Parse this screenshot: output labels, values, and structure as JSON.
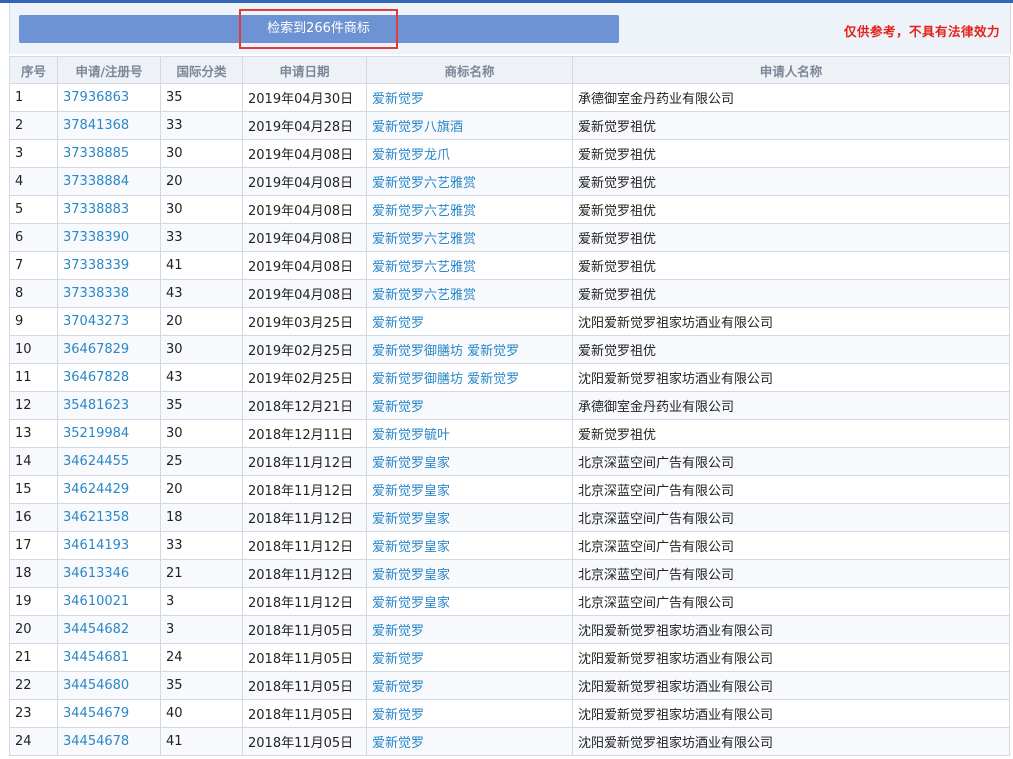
{
  "header": {
    "result_text": "检索到266件商标",
    "disclaimer": "仅供参考，不具有法律效力"
  },
  "table": {
    "columns": [
      "序号",
      "申请/注册号",
      "国际分类",
      "申请日期",
      "商标名称",
      "申请人名称"
    ],
    "rows": [
      {
        "no": "1",
        "reg": "37936863",
        "cls": "35",
        "date": "2019年04月30日",
        "name": "爱新觉罗",
        "applicant": "承德御室金丹药业有限公司"
      },
      {
        "no": "2",
        "reg": "37841368",
        "cls": "33",
        "date": "2019年04月28日",
        "name": "爱新觉罗八旗酒",
        "applicant": "爱新觉罗祖优"
      },
      {
        "no": "3",
        "reg": "37338885",
        "cls": "30",
        "date": "2019年04月08日",
        "name": "爱新觉罗龙爪",
        "applicant": "爱新觉罗祖优"
      },
      {
        "no": "4",
        "reg": "37338884",
        "cls": "20",
        "date": "2019年04月08日",
        "name": "爱新觉罗六艺雅赏",
        "applicant": "爱新觉罗祖优"
      },
      {
        "no": "5",
        "reg": "37338883",
        "cls": "30",
        "date": "2019年04月08日",
        "name": "爱新觉罗六艺雅赏",
        "applicant": "爱新觉罗祖优"
      },
      {
        "no": "6",
        "reg": "37338390",
        "cls": "33",
        "date": "2019年04月08日",
        "name": "爱新觉罗六艺雅赏",
        "applicant": "爱新觉罗祖优"
      },
      {
        "no": "7",
        "reg": "37338339",
        "cls": "41",
        "date": "2019年04月08日",
        "name": "爱新觉罗六艺雅赏",
        "applicant": "爱新觉罗祖优"
      },
      {
        "no": "8",
        "reg": "37338338",
        "cls": "43",
        "date": "2019年04月08日",
        "name": "爱新觉罗六艺雅赏",
        "applicant": "爱新觉罗祖优"
      },
      {
        "no": "9",
        "reg": "37043273",
        "cls": "20",
        "date": "2019年03月25日",
        "name": "爱新觉罗",
        "applicant": "沈阳爱新觉罗祖家坊酒业有限公司"
      },
      {
        "no": "10",
        "reg": "36467829",
        "cls": "30",
        "date": "2019年02月25日",
        "name": "爱新觉罗御膳坊 爱新觉罗",
        "applicant": "爱新觉罗祖优"
      },
      {
        "no": "11",
        "reg": "36467828",
        "cls": "43",
        "date": "2019年02月25日",
        "name": "爱新觉罗御膳坊 爱新觉罗",
        "applicant": "沈阳爱新觉罗祖家坊酒业有限公司"
      },
      {
        "no": "12",
        "reg": "35481623",
        "cls": "35",
        "date": "2018年12月21日",
        "name": "爱新觉罗",
        "applicant": "承德御室金丹药业有限公司"
      },
      {
        "no": "13",
        "reg": "35219984",
        "cls": "30",
        "date": "2018年12月11日",
        "name": "爱新觉罗毓叶",
        "applicant": "爱新觉罗祖优"
      },
      {
        "no": "14",
        "reg": "34624455",
        "cls": "25",
        "date": "2018年11月12日",
        "name": "爱新觉罗皇家",
        "applicant": "北京深蓝空间广告有限公司"
      },
      {
        "no": "15",
        "reg": "34624429",
        "cls": "20",
        "date": "2018年11月12日",
        "name": "爱新觉罗皇家",
        "applicant": "北京深蓝空间广告有限公司"
      },
      {
        "no": "16",
        "reg": "34621358",
        "cls": "18",
        "date": "2018年11月12日",
        "name": "爱新觉罗皇家",
        "applicant": "北京深蓝空间广告有限公司"
      },
      {
        "no": "17",
        "reg": "34614193",
        "cls": "33",
        "date": "2018年11月12日",
        "name": "爱新觉罗皇家",
        "applicant": "北京深蓝空间广告有限公司"
      },
      {
        "no": "18",
        "reg": "34613346",
        "cls": "21",
        "date": "2018年11月12日",
        "name": "爱新觉罗皇家",
        "applicant": "北京深蓝空间广告有限公司"
      },
      {
        "no": "19",
        "reg": "34610021",
        "cls": "3",
        "date": "2018年11月12日",
        "name": "爱新觉罗皇家",
        "applicant": "北京深蓝空间广告有限公司"
      },
      {
        "no": "20",
        "reg": "34454682",
        "cls": "3",
        "date": "2018年11月05日",
        "name": "爱新觉罗",
        "applicant": "沈阳爱新觉罗祖家坊酒业有限公司"
      },
      {
        "no": "21",
        "reg": "34454681",
        "cls": "24",
        "date": "2018年11月05日",
        "name": "爱新觉罗",
        "applicant": "沈阳爱新觉罗祖家坊酒业有限公司"
      },
      {
        "no": "22",
        "reg": "34454680",
        "cls": "35",
        "date": "2018年11月05日",
        "name": "爱新觉罗",
        "applicant": "沈阳爱新觉罗祖家坊酒业有限公司"
      },
      {
        "no": "23",
        "reg": "34454679",
        "cls": "40",
        "date": "2018年11月05日",
        "name": "爱新觉罗",
        "applicant": "沈阳爱新觉罗祖家坊酒业有限公司"
      },
      {
        "no": "24",
        "reg": "34454678",
        "cls": "41",
        "date": "2018年11月05日",
        "name": "爱新觉罗",
        "applicant": "沈阳爱新觉罗祖家坊酒业有限公司"
      }
    ]
  }
}
